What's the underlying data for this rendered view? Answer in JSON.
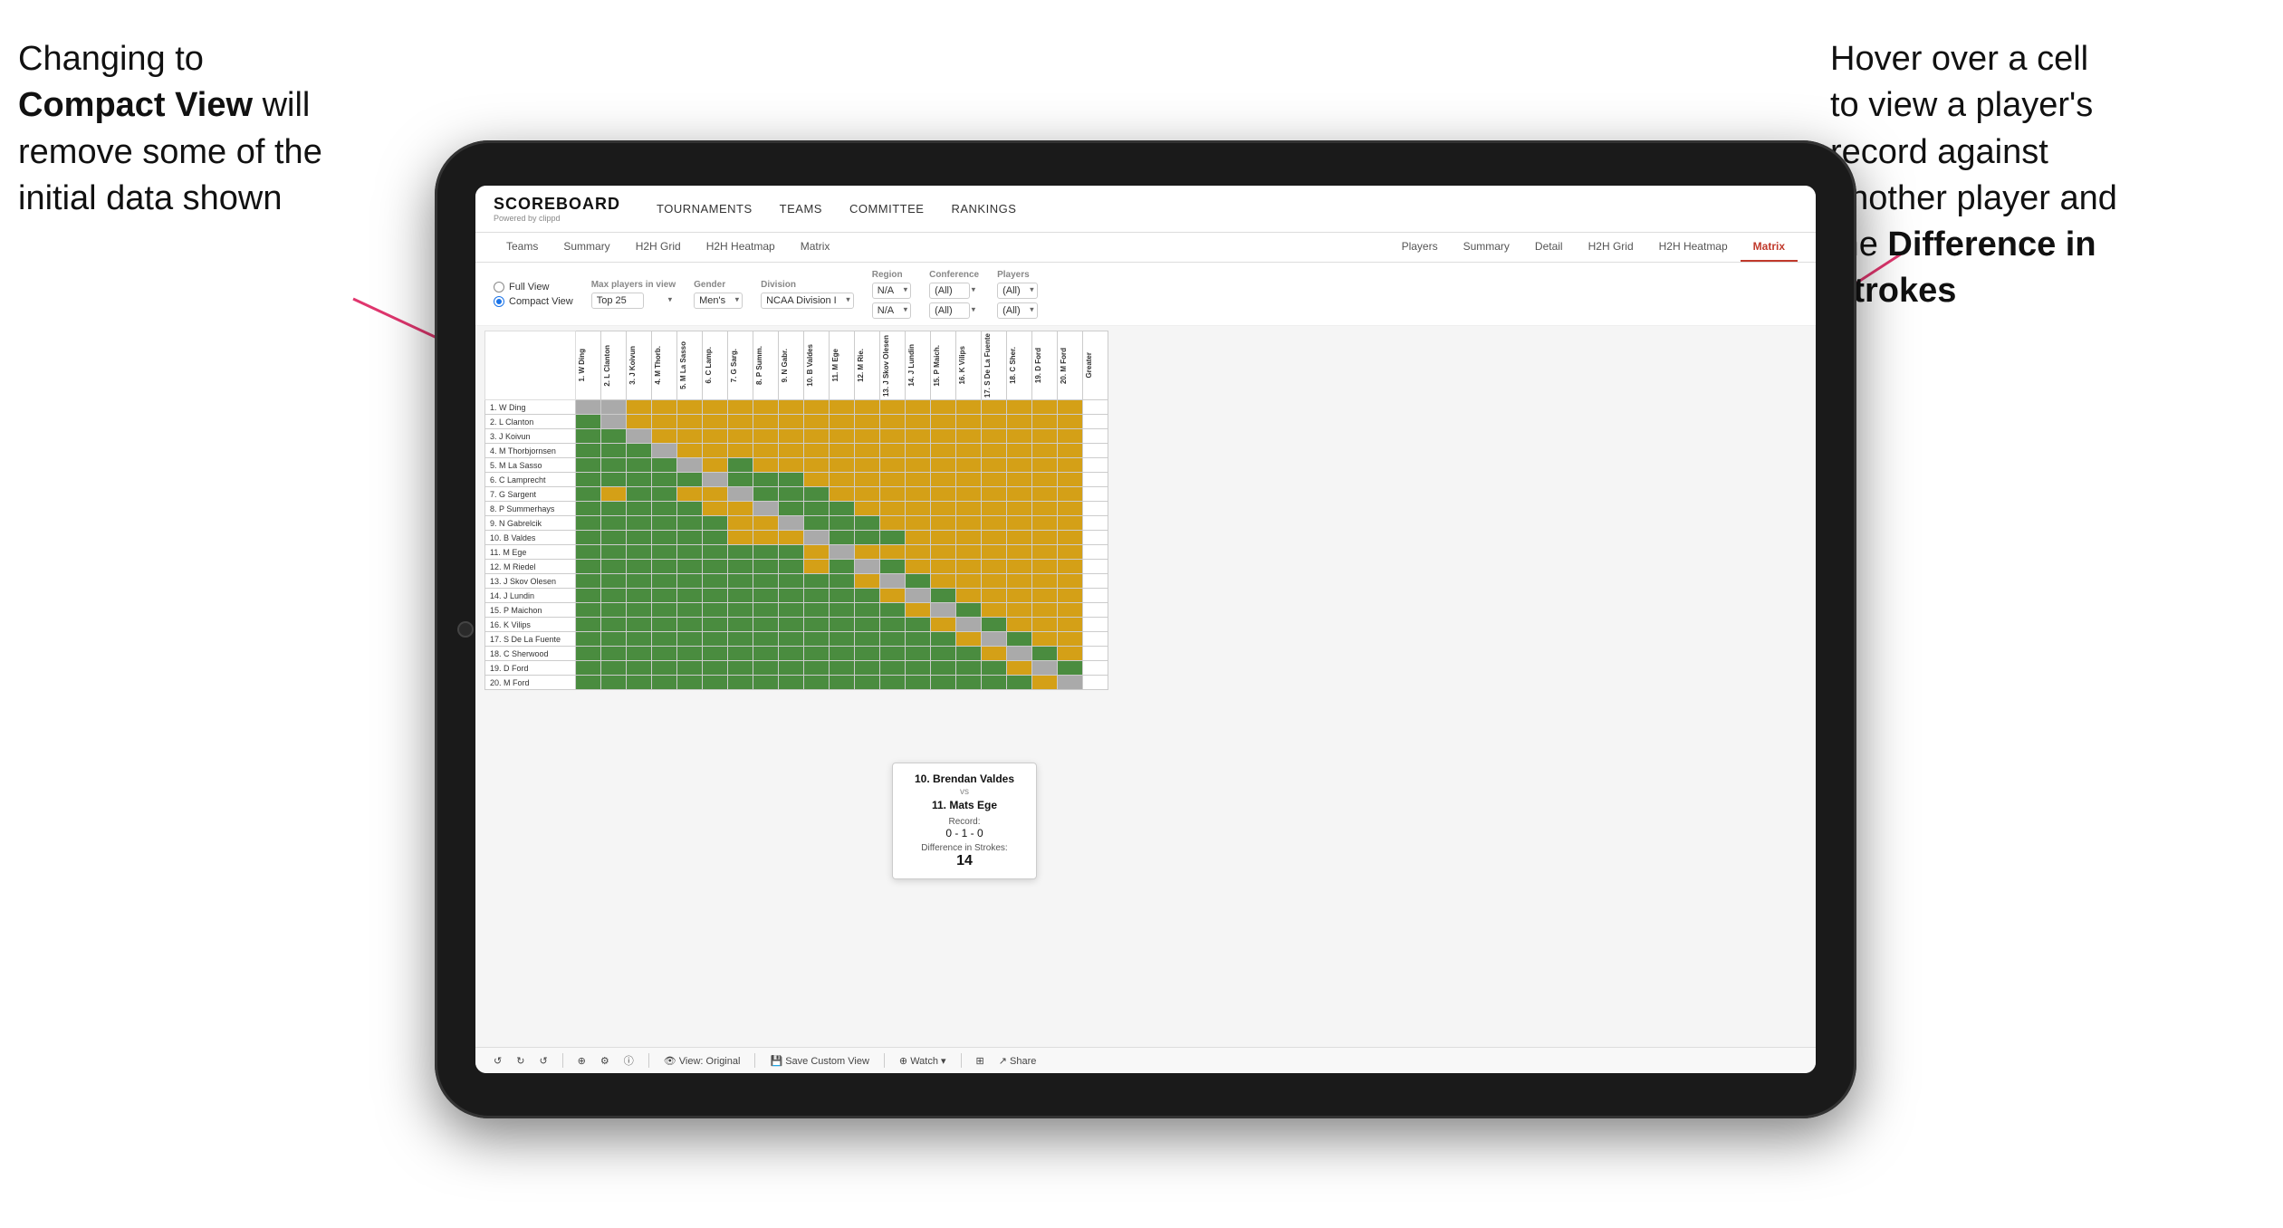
{
  "annotations": {
    "left_line1": "Changing to",
    "left_line2": "Compact View will",
    "left_line3": "remove some of the",
    "left_line4": "initial data shown",
    "right_line1": "Hover over a cell",
    "right_line2": "to view a player's",
    "right_line3": "record against",
    "right_line4": "another player and",
    "right_line5": "the ",
    "right_bold": "Difference in Strokes"
  },
  "app": {
    "logo": "SCOREBOARD",
    "logo_sub": "Powered by clippd",
    "nav": [
      "TOURNAMENTS",
      "TEAMS",
      "COMMITTEE",
      "RANKINGS"
    ]
  },
  "tabs": {
    "top": [
      "Teams",
      "Summary",
      "H2H Grid",
      "H2H Heatmap",
      "Matrix"
    ],
    "bottom": [
      "Players",
      "Summary",
      "Detail",
      "H2H Grid",
      "H2H Heatmap",
      "Matrix"
    ],
    "active_bottom": "Matrix"
  },
  "filters": {
    "view_options": [
      "Full View",
      "Compact View"
    ],
    "selected_view": "Compact View",
    "max_players_label": "Max players in view",
    "max_players_value": "Top 25",
    "gender_label": "Gender",
    "gender_value": "Men's",
    "division_label": "Division",
    "division_value": "NCAA Division I",
    "region_label": "Region",
    "region_values": [
      "N/A",
      "N/A"
    ],
    "conference_label": "Conference",
    "conference_values": [
      "(All)",
      "(All)"
    ],
    "players_label": "Players",
    "players_values": [
      "(All)",
      "(All)"
    ]
  },
  "players": [
    "1. W Ding",
    "2. L Clanton",
    "3. J Koivun",
    "4. M Thorbjornsen",
    "5. M La Sasso",
    "6. C Lamprecht",
    "7. G Sargent",
    "8. P Summerhays",
    "9. N Gabrelcik",
    "10. B Valdes",
    "11. M Ege",
    "12. M Riedel",
    "13. J Skov Olesen",
    "14. J Lundin",
    "15. P Maichon",
    "16. K Vilips",
    "17. S De La Fuente",
    "18. C Sherwood",
    "19. D Ford",
    "20. M Ford"
  ],
  "column_headers": [
    "1. W Ding",
    "2. L Clanton",
    "3. J Koivun",
    "4. M Thorb.",
    "5. M La Sasso",
    "6. C Lamp.",
    "7. G Sarg.",
    "8. P Summ.",
    "9. N Gabr.",
    "10. B Valdes",
    "11. M Ege",
    "12. M Rie.",
    "13. J Skov Olesen",
    "14. J Lundin",
    "15. P Maich.",
    "16. K Vilips",
    "17. S De La Fuente",
    "18. C Sher.",
    "19. D Ford",
    "20. M Ford",
    "Greater"
  ],
  "tooltip": {
    "player1": "10. Brendan Valdes",
    "vs": "vs",
    "player2": "11. Mats Ege",
    "record_label": "Record:",
    "record": "0 - 1 - 0",
    "diff_label": "Difference in Strokes:",
    "diff": "14"
  },
  "toolbar": {
    "undo": "↺",
    "view_original": "View: Original",
    "save_custom": "Save Custom View",
    "watch": "Watch ▾",
    "share": "Share"
  }
}
